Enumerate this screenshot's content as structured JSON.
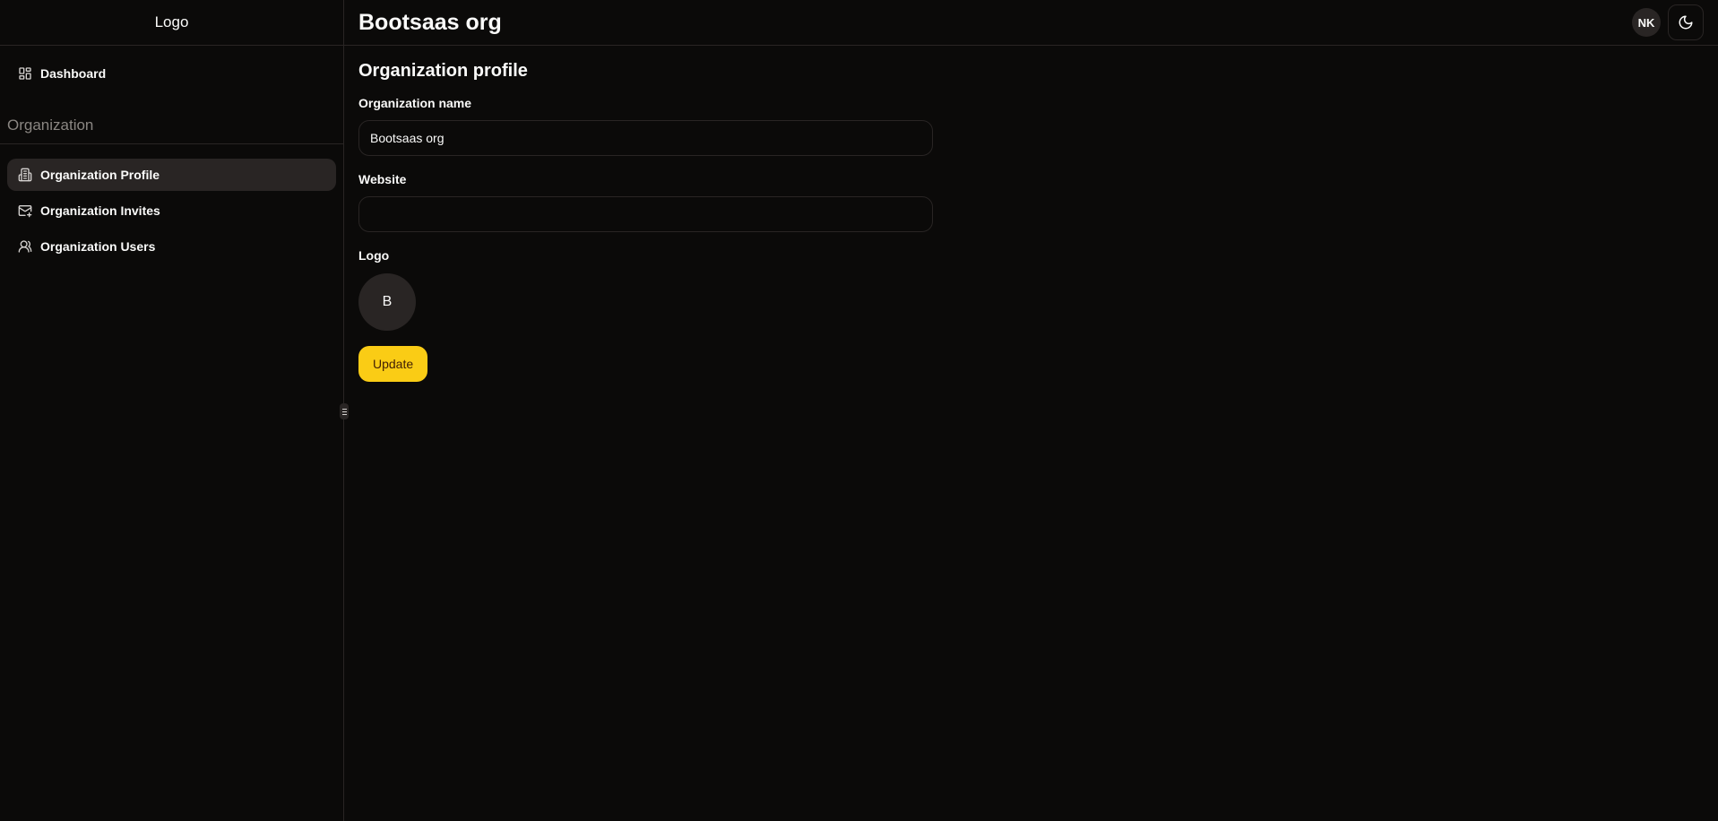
{
  "sidebar": {
    "logo_text": "Logo",
    "top_items": [
      {
        "label": "Dashboard",
        "icon": "dashboard-grid-icon",
        "active": false
      }
    ],
    "group_label": "Organization",
    "group_items": [
      {
        "label": "Organization Profile",
        "icon": "building-icon",
        "active": true
      },
      {
        "label": "Organization Invites",
        "icon": "mail-plus-icon",
        "active": false
      },
      {
        "label": "Organization Users",
        "icon": "users-icon",
        "active": false
      }
    ]
  },
  "header": {
    "title": "Bootsaas org",
    "user_initials": "NK",
    "theme_toggle_icon": "moon-icon"
  },
  "form": {
    "section_title": "Organization profile",
    "name_label": "Organization name",
    "name_value": "Bootsaas org",
    "website_label": "Website",
    "website_value": "",
    "logo_label": "Logo",
    "logo_initial": "B",
    "submit_label": "Update"
  },
  "colors": {
    "background": "#0b0a09",
    "border": "#292524",
    "active_bg": "#292524",
    "muted_text": "#8a8682",
    "accent": "#facc15",
    "accent_text": "#422006"
  }
}
